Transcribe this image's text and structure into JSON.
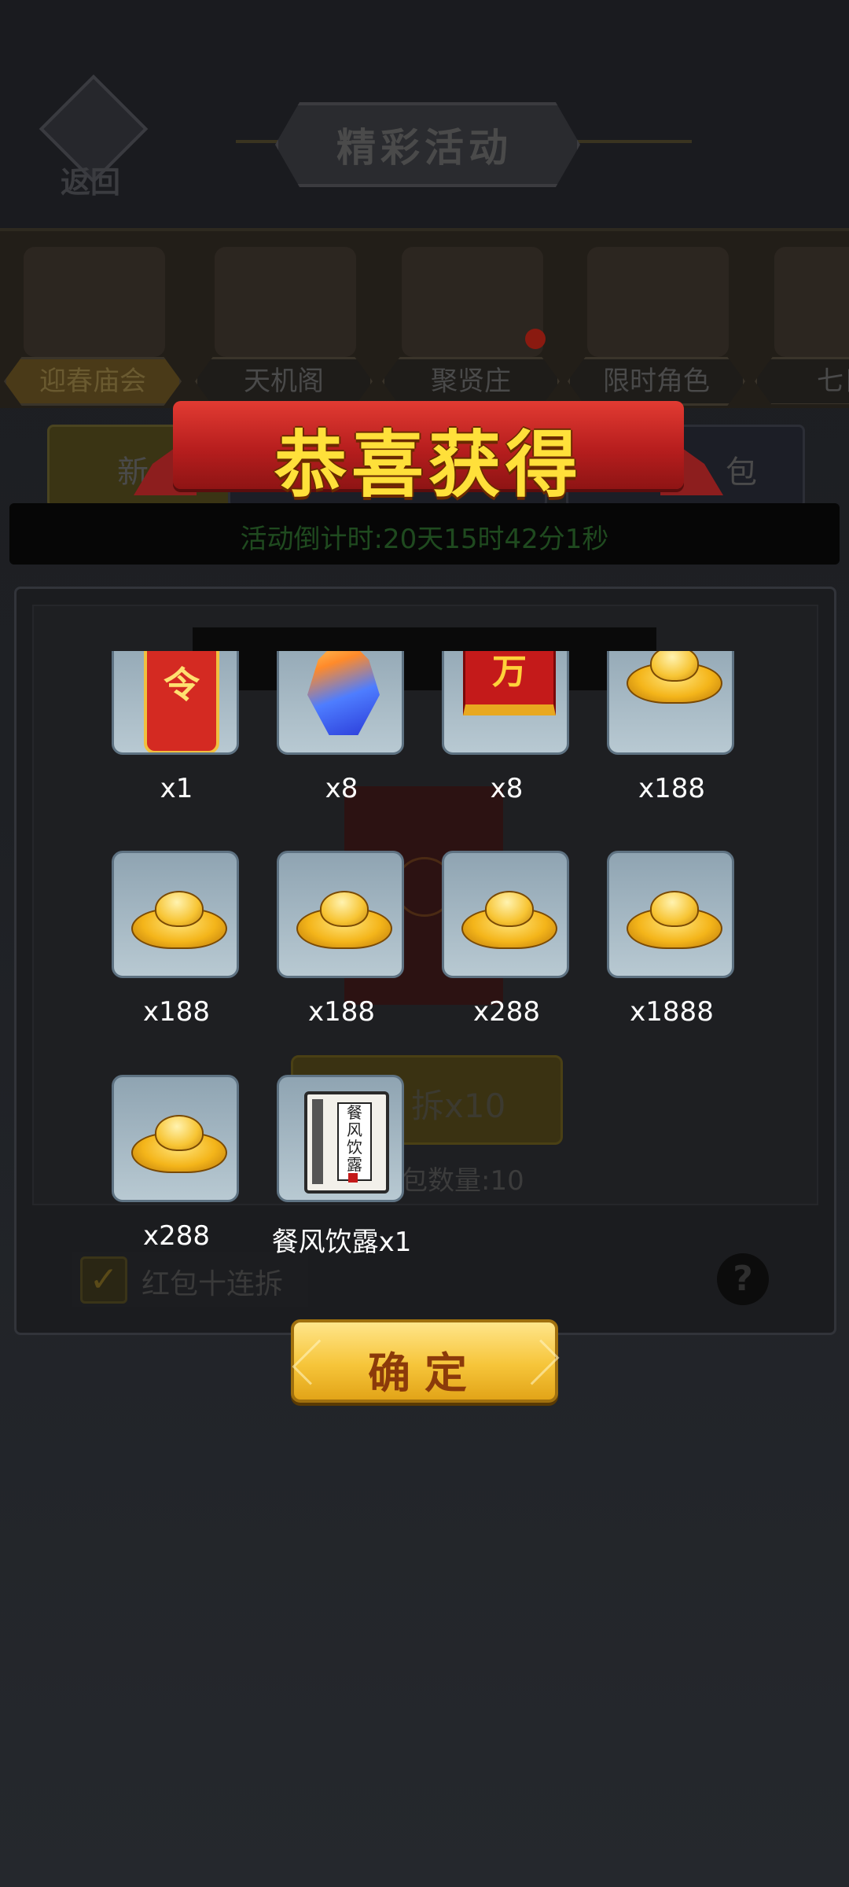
{
  "header": {
    "back_label": "返回",
    "title": "精彩活动"
  },
  "tabs": [
    {
      "label": "迎春庙会",
      "active": true
    },
    {
      "label": "天机阁",
      "active": false
    },
    {
      "label": "聚贤庄",
      "active": false
    },
    {
      "label": "限时角色",
      "active": false
    },
    {
      "label": "七日",
      "active": false
    }
  ],
  "subtabs": [
    {
      "label": "新"
    },
    {
      "label": "包"
    }
  ],
  "countdown": "活动倒计时:20天15时42分1秒",
  "background_panel": {
    "open_button": "拆x10",
    "count_label": "包数量:10",
    "checkbox_label": "红包十连拆",
    "help_icon": "?"
  },
  "popup": {
    "banner_title": "恭喜获得",
    "confirm_label": "确定",
    "rewards": [
      {
        "icon": "command-token-icon",
        "qty": "x1"
      },
      {
        "icon": "crystal-icon",
        "qty": "x8"
      },
      {
        "icon": "red-book-icon",
        "glyph": "万",
        "qty": "x8"
      },
      {
        "icon": "gold-ingot-icon",
        "qty": "x188"
      },
      {
        "icon": "gold-ingot-icon",
        "qty": "x188"
      },
      {
        "icon": "gold-ingot-icon",
        "qty": "x188"
      },
      {
        "icon": "gold-ingot-icon",
        "qty": "x288"
      },
      {
        "icon": "gold-ingot-icon",
        "qty": "x1888"
      },
      {
        "icon": "gold-ingot-icon",
        "qty": "x288"
      },
      {
        "icon": "scroll-book-icon",
        "qty": "餐风饮露x1"
      }
    ]
  },
  "colors": {
    "banner_red": "#c62828",
    "banner_text": "#ffe03a",
    "confirm_gold": "#f6c53a",
    "tile_blue": "#a9bcc8"
  }
}
